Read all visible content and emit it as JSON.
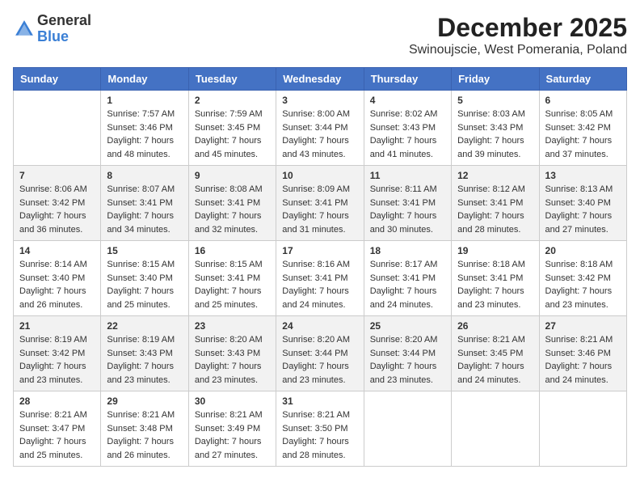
{
  "header": {
    "logo_general": "General",
    "logo_blue": "Blue",
    "month_title": "December 2025",
    "location": "Swinoujscie, West Pomerania, Poland"
  },
  "days_of_week": [
    "Sunday",
    "Monday",
    "Tuesday",
    "Wednesday",
    "Thursday",
    "Friday",
    "Saturday"
  ],
  "weeks": [
    [
      {
        "day": "",
        "info": ""
      },
      {
        "day": "1",
        "info": "Sunrise: 7:57 AM\nSunset: 3:46 PM\nDaylight: 7 hours\nand 48 minutes."
      },
      {
        "day": "2",
        "info": "Sunrise: 7:59 AM\nSunset: 3:45 PM\nDaylight: 7 hours\nand 45 minutes."
      },
      {
        "day": "3",
        "info": "Sunrise: 8:00 AM\nSunset: 3:44 PM\nDaylight: 7 hours\nand 43 minutes."
      },
      {
        "day": "4",
        "info": "Sunrise: 8:02 AM\nSunset: 3:43 PM\nDaylight: 7 hours\nand 41 minutes."
      },
      {
        "day": "5",
        "info": "Sunrise: 8:03 AM\nSunset: 3:43 PM\nDaylight: 7 hours\nand 39 minutes."
      },
      {
        "day": "6",
        "info": "Sunrise: 8:05 AM\nSunset: 3:42 PM\nDaylight: 7 hours\nand 37 minutes."
      }
    ],
    [
      {
        "day": "7",
        "info": "Sunrise: 8:06 AM\nSunset: 3:42 PM\nDaylight: 7 hours\nand 36 minutes."
      },
      {
        "day": "8",
        "info": "Sunrise: 8:07 AM\nSunset: 3:41 PM\nDaylight: 7 hours\nand 34 minutes."
      },
      {
        "day": "9",
        "info": "Sunrise: 8:08 AM\nSunset: 3:41 PM\nDaylight: 7 hours\nand 32 minutes."
      },
      {
        "day": "10",
        "info": "Sunrise: 8:09 AM\nSunset: 3:41 PM\nDaylight: 7 hours\nand 31 minutes."
      },
      {
        "day": "11",
        "info": "Sunrise: 8:11 AM\nSunset: 3:41 PM\nDaylight: 7 hours\nand 30 minutes."
      },
      {
        "day": "12",
        "info": "Sunrise: 8:12 AM\nSunset: 3:41 PM\nDaylight: 7 hours\nand 28 minutes."
      },
      {
        "day": "13",
        "info": "Sunrise: 8:13 AM\nSunset: 3:40 PM\nDaylight: 7 hours\nand 27 minutes."
      }
    ],
    [
      {
        "day": "14",
        "info": "Sunrise: 8:14 AM\nSunset: 3:40 PM\nDaylight: 7 hours\nand 26 minutes."
      },
      {
        "day": "15",
        "info": "Sunrise: 8:15 AM\nSunset: 3:40 PM\nDaylight: 7 hours\nand 25 minutes."
      },
      {
        "day": "16",
        "info": "Sunrise: 8:15 AM\nSunset: 3:41 PM\nDaylight: 7 hours\nand 25 minutes."
      },
      {
        "day": "17",
        "info": "Sunrise: 8:16 AM\nSunset: 3:41 PM\nDaylight: 7 hours\nand 24 minutes."
      },
      {
        "day": "18",
        "info": "Sunrise: 8:17 AM\nSunset: 3:41 PM\nDaylight: 7 hours\nand 24 minutes."
      },
      {
        "day": "19",
        "info": "Sunrise: 8:18 AM\nSunset: 3:41 PM\nDaylight: 7 hours\nand 23 minutes."
      },
      {
        "day": "20",
        "info": "Sunrise: 8:18 AM\nSunset: 3:42 PM\nDaylight: 7 hours\nand 23 minutes."
      }
    ],
    [
      {
        "day": "21",
        "info": "Sunrise: 8:19 AM\nSunset: 3:42 PM\nDaylight: 7 hours\nand 23 minutes."
      },
      {
        "day": "22",
        "info": "Sunrise: 8:19 AM\nSunset: 3:43 PM\nDaylight: 7 hours\nand 23 minutes."
      },
      {
        "day": "23",
        "info": "Sunrise: 8:20 AM\nSunset: 3:43 PM\nDaylight: 7 hours\nand 23 minutes."
      },
      {
        "day": "24",
        "info": "Sunrise: 8:20 AM\nSunset: 3:44 PM\nDaylight: 7 hours\nand 23 minutes."
      },
      {
        "day": "25",
        "info": "Sunrise: 8:20 AM\nSunset: 3:44 PM\nDaylight: 7 hours\nand 23 minutes."
      },
      {
        "day": "26",
        "info": "Sunrise: 8:21 AM\nSunset: 3:45 PM\nDaylight: 7 hours\nand 24 minutes."
      },
      {
        "day": "27",
        "info": "Sunrise: 8:21 AM\nSunset: 3:46 PM\nDaylight: 7 hours\nand 24 minutes."
      }
    ],
    [
      {
        "day": "28",
        "info": "Sunrise: 8:21 AM\nSunset: 3:47 PM\nDaylight: 7 hours\nand 25 minutes."
      },
      {
        "day": "29",
        "info": "Sunrise: 8:21 AM\nSunset: 3:48 PM\nDaylight: 7 hours\nand 26 minutes."
      },
      {
        "day": "30",
        "info": "Sunrise: 8:21 AM\nSunset: 3:49 PM\nDaylight: 7 hours\nand 27 minutes."
      },
      {
        "day": "31",
        "info": "Sunrise: 8:21 AM\nSunset: 3:50 PM\nDaylight: 7 hours\nand 28 minutes."
      },
      {
        "day": "",
        "info": ""
      },
      {
        "day": "",
        "info": ""
      },
      {
        "day": "",
        "info": ""
      }
    ]
  ]
}
